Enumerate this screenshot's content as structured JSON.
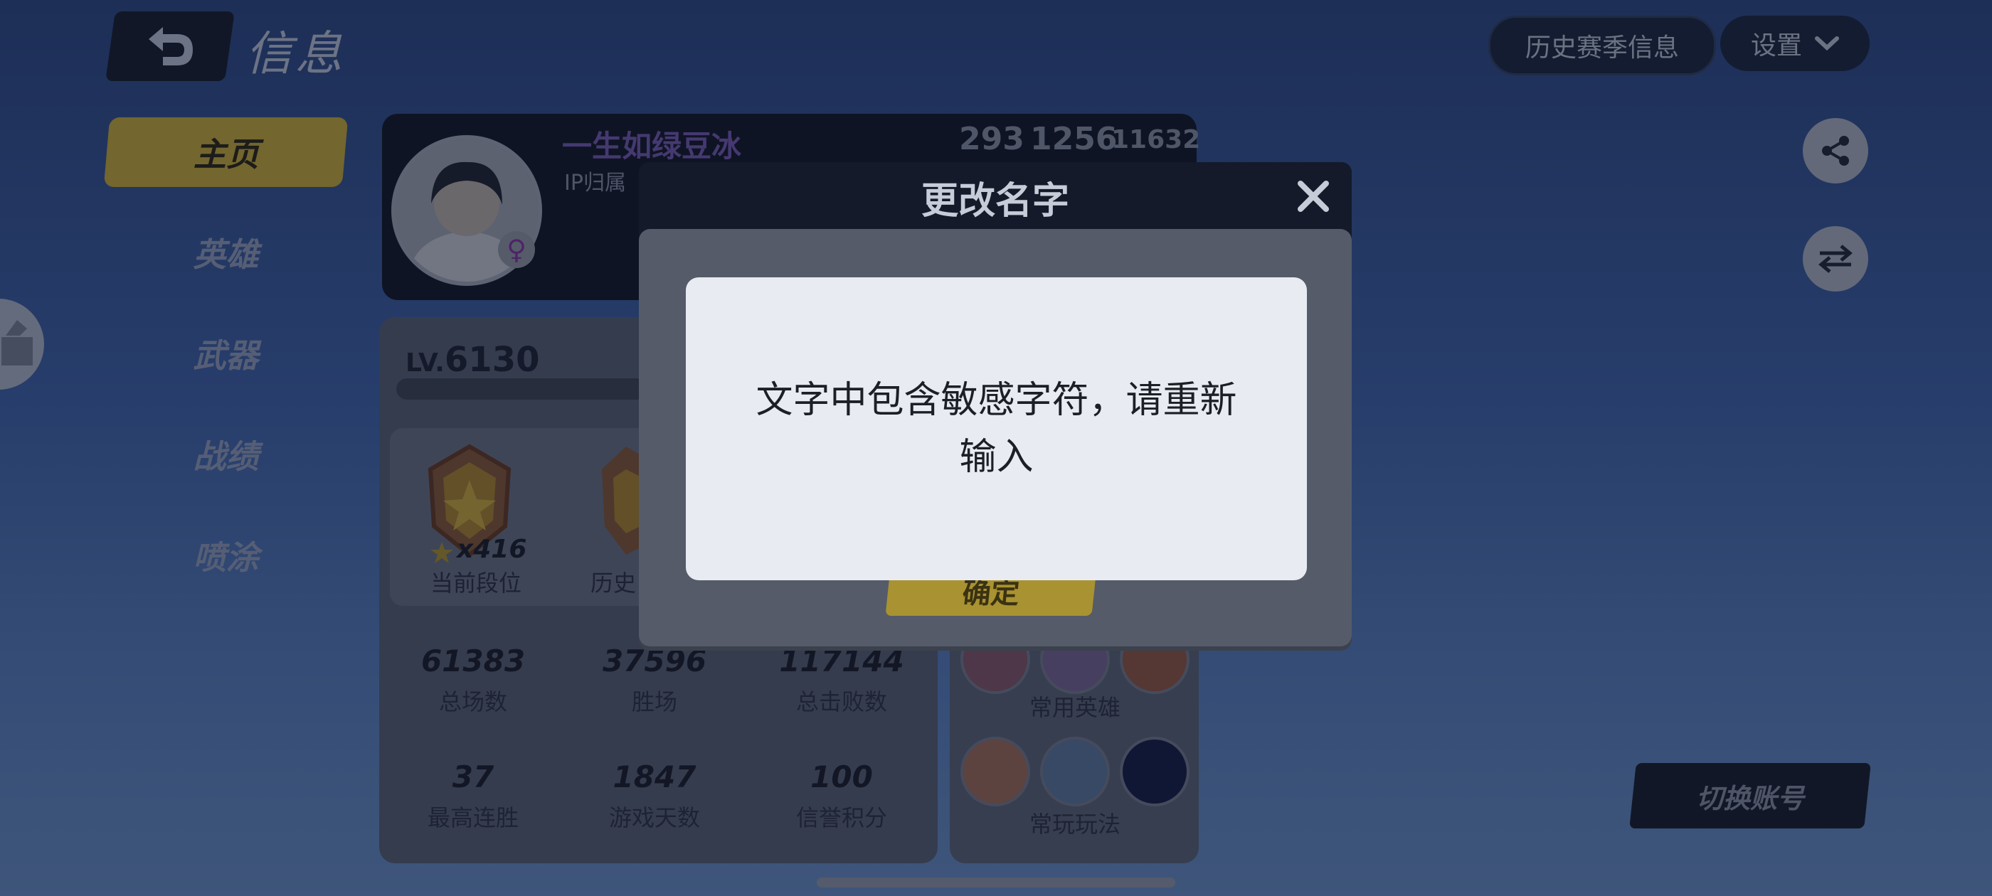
{
  "header": {
    "title": "信息",
    "history_label": "历史赛季信息",
    "settings_label": "设置"
  },
  "sidebar": {
    "items": [
      {
        "label": "主页",
        "active": true
      },
      {
        "label": "英雄",
        "active": false
      },
      {
        "label": "武器",
        "active": false
      },
      {
        "label": "战绩",
        "active": false
      },
      {
        "label": "喷涂",
        "active": false
      }
    ]
  },
  "profile": {
    "name": "一生如绿豆冰",
    "ip_text": "IP归属",
    "stat_a": "293",
    "stat_b": "1256",
    "stat_c": "11632",
    "gender_icon": "female-icon"
  },
  "level": {
    "prefix": "LV.",
    "value": "6130"
  },
  "ranks": {
    "star_count": "x416",
    "current_label": "当前段位",
    "history_label": "历史"
  },
  "stats": [
    {
      "value": "61383",
      "label": "总场数"
    },
    {
      "value": "37596",
      "label": "胜场"
    },
    {
      "value": "117144",
      "label": "总击败数"
    },
    {
      "value": "37",
      "label": "最高连胜"
    },
    {
      "value": "1847",
      "label": "游戏天数"
    },
    {
      "value": "100",
      "label": "信誉积分"
    }
  ],
  "heroes": {
    "common_heroes_label": "常用英雄",
    "common_modes_label": "常玩玩法"
  },
  "switch_account_label": "切换账号",
  "dialog": {
    "title": "更改名字",
    "confirm_label": "确定"
  },
  "toast": {
    "message": "文字中包含敏感字符，请重新输入"
  },
  "colors": {
    "accent": "#d7b938",
    "name_color": "#7b5fbf"
  }
}
